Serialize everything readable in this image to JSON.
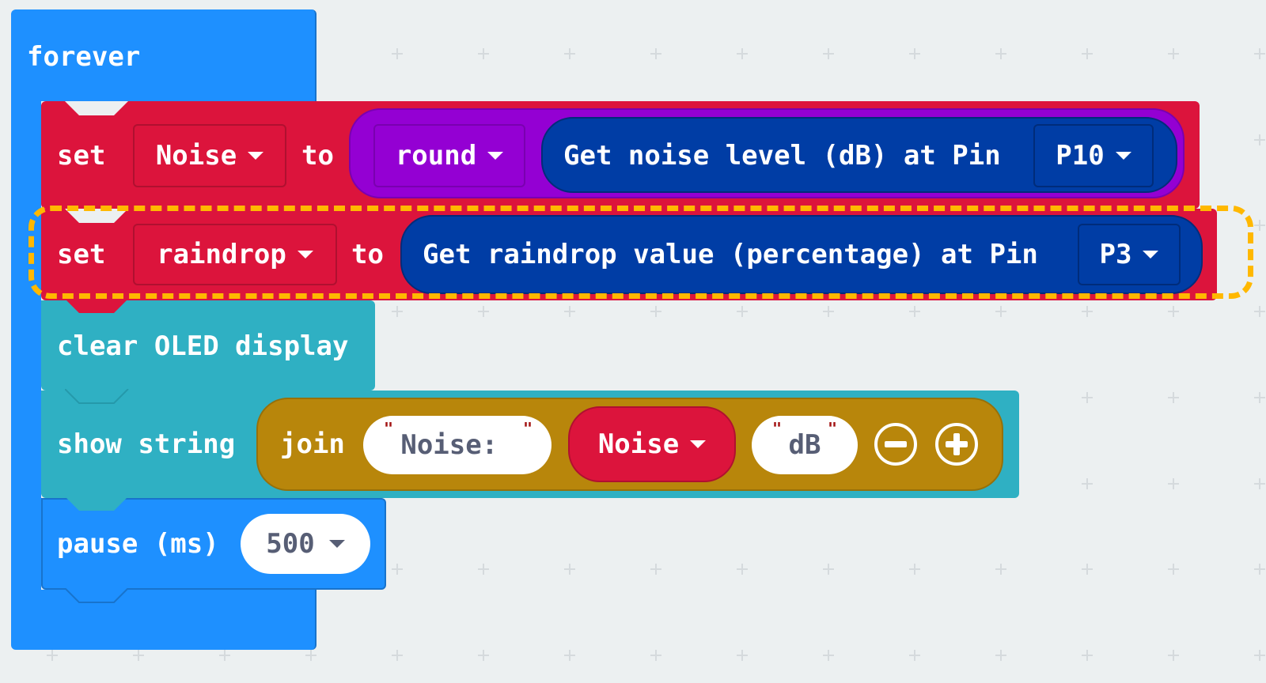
{
  "colors": {
    "loops": "#1e90ff",
    "variables": "#dc143c",
    "math": "#9400d3",
    "sensor": "#003da5",
    "oled": "#2fb0c3",
    "text": "#b8860b",
    "basic": "#1e90ff",
    "highlight": "#ffb800",
    "workspace": "#ecf0f1"
  },
  "forever": {
    "label": "forever"
  },
  "set_noise": {
    "set_label": "set",
    "variable": "Noise",
    "to_label": "to",
    "round_label": "round",
    "sensor_label": "Get noise level (dB) at Pin",
    "pin": "P10"
  },
  "set_raindrop": {
    "set_label": "set",
    "variable": "raindrop",
    "to_label": "to",
    "sensor_label": "Get raindrop value (percentage) at Pin",
    "pin": "P3"
  },
  "clear_oled": {
    "label": "clear OLED display"
  },
  "show_string": {
    "label": "show string",
    "join_label": "join",
    "string1": "Noise: ",
    "variable": "Noise",
    "string2": "dB",
    "remove_icon": "minus-circle-icon",
    "add_icon": "plus-circle-icon"
  },
  "pause": {
    "label": "pause (ms)",
    "value": "500"
  }
}
